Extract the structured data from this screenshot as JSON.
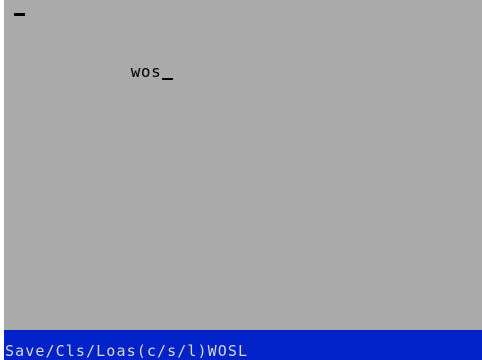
{
  "editor": {
    "text": "wos"
  },
  "status_bar": {
    "text": "Save/Cls/Loas(c/s/l)WOSL"
  },
  "colors": {
    "paper": "#aaaaaa",
    "ink": "#000000",
    "status_background": "#0022c8",
    "status_text": "#d8d8d8"
  }
}
